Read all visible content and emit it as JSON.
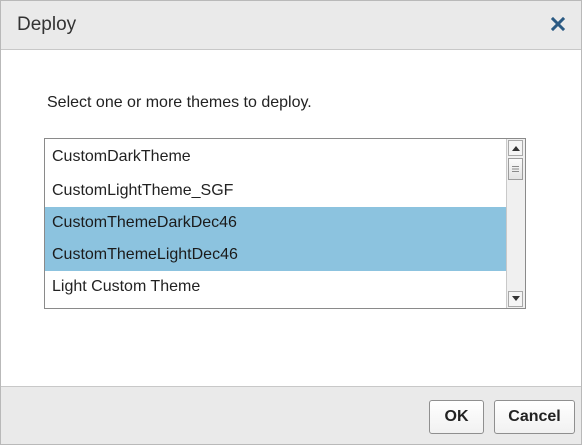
{
  "dialog": {
    "title": "Deploy",
    "close_icon": "close-icon",
    "instructions": "Select one or more themes to deploy.",
    "themes": [
      {
        "label": "CustomDarkTheme",
        "selected": false
      },
      {
        "label": "CustomLightTheme_SGF",
        "selected": false
      },
      {
        "label": "CustomThemeDarkDec46",
        "selected": true
      },
      {
        "label": "CustomThemeLightDec46",
        "selected": true
      },
      {
        "label": "Light Custom Theme",
        "selected": false
      }
    ],
    "ok_label": "OK",
    "cancel_label": "Cancel"
  },
  "colors": {
    "selection": "#8cc3df",
    "titlebar_bg": "#eaeaea",
    "close_icon": "#2b5a83"
  }
}
